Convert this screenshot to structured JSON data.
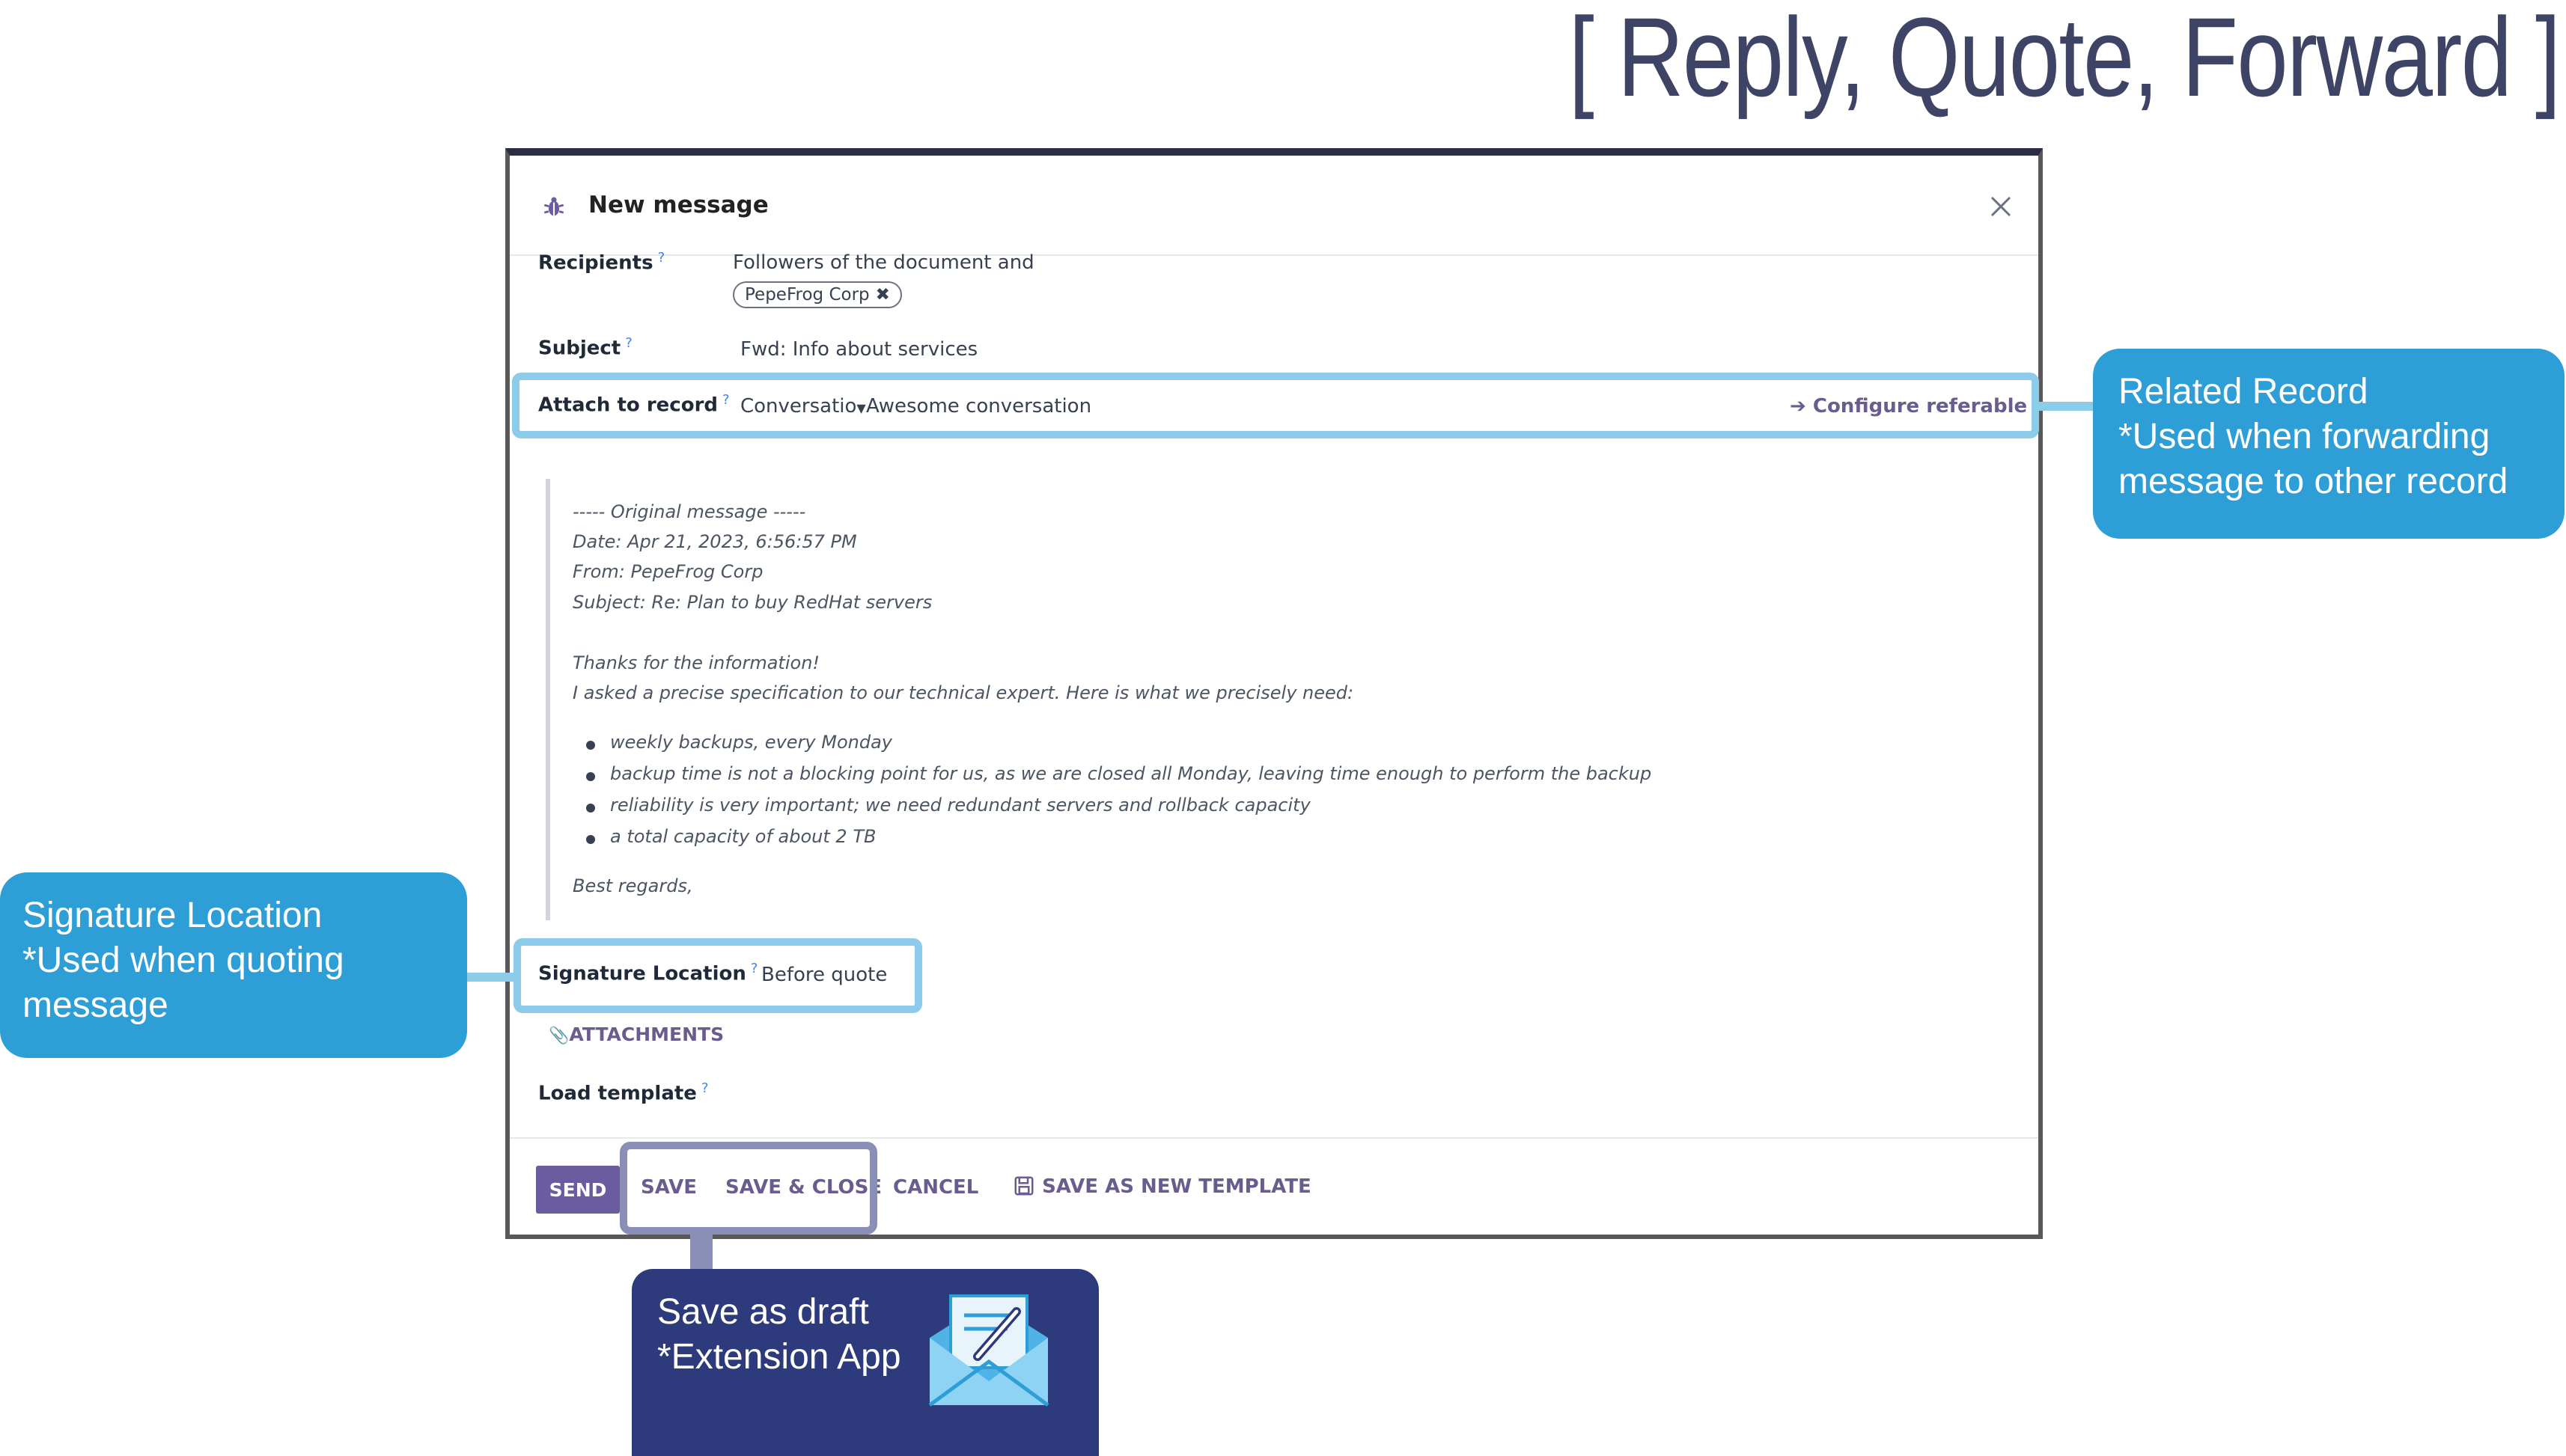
{
  "headline": "[ Reply, Quote, Forward ]",
  "dialog": {
    "title": "New message",
    "help_mark": "?",
    "recipients": {
      "label": "Recipients",
      "text": "Followers of the document and",
      "tag": "PepeFrog Corp"
    },
    "subject": {
      "label": "Subject",
      "value": "Fwd: Info about services"
    },
    "attach_to_record": {
      "label": "Attach to record",
      "model": "Conversatio",
      "record": "Awesome conversation",
      "configure_link": "Configure referable"
    },
    "quote": {
      "header": "----- Original message -----",
      "date": "Date: Apr 21, 2023, 6:56:57 PM",
      "from": "From: PepeFrog Corp",
      "subject": "Subject: Re: Plan to buy RedHat servers",
      "line1": "Thanks for the information!",
      "line2": "I asked a precise specification to our technical expert. Here is what we precisely need:",
      "bullets": [
        "weekly backups, every Monday",
        "backup time is not a blocking point for us, as we are closed all Monday, leaving time enough to perform the backup",
        "reliability is very important; we need redundant servers and rollback capacity",
        "a total capacity of about 2 TB"
      ],
      "closing": "Best regards,"
    },
    "signature_location": {
      "label": "Signature Location",
      "value": "Before quote"
    },
    "attachments_label": "ATTACHMENTS",
    "load_template_label": "Load template",
    "buttons": {
      "send": "SEND",
      "save": "SAVE",
      "save_close": "SAVE & CLOSE",
      "cancel": "CANCEL",
      "save_template": "SAVE AS NEW TEMPLATE"
    }
  },
  "callouts": {
    "related_record": {
      "line1": "Related Record",
      "line2": "*Used when forwarding",
      "line3": "message to other record"
    },
    "signature": {
      "line1": "Signature Location",
      "line2": "*Used when quoting message"
    },
    "draft": {
      "line1": "Save as draft",
      "line2": "*Extension App"
    }
  },
  "colors": {
    "callout_blue": "#2e9fd6",
    "callout_navy": "#2d3a7c",
    "highlight_blue": "#8ccbea",
    "highlight_purple": "#8a8fb8",
    "accent_purple": "#6b5c9f"
  }
}
